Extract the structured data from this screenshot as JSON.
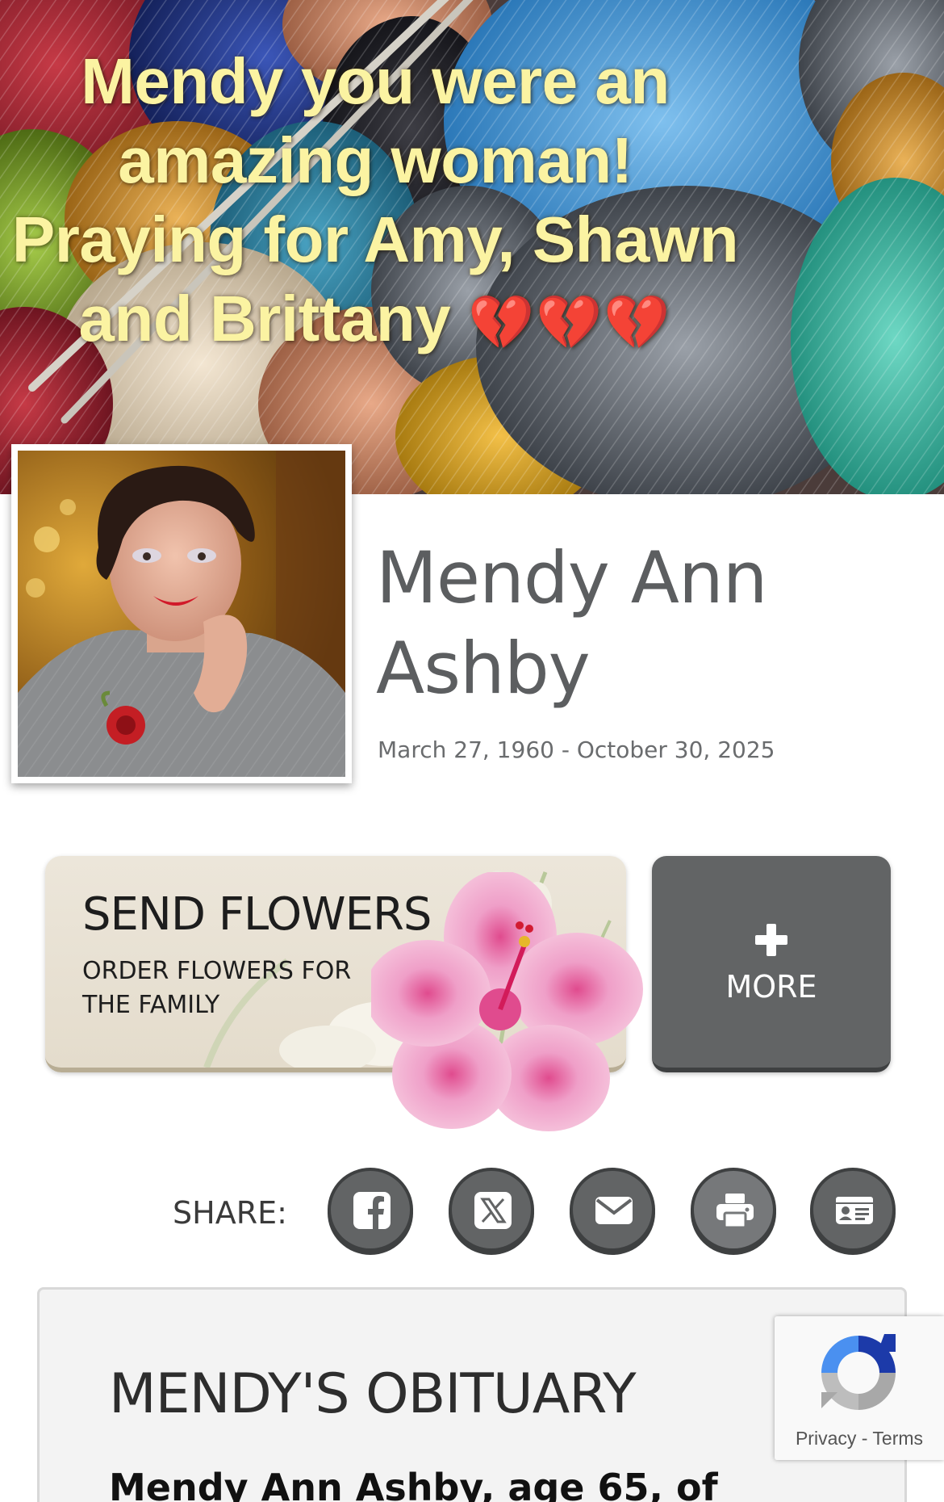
{
  "hero": {
    "message": "Mendy you were an amazing woman! Praying for Amy, Shawn and Brittany",
    "hearts": "💔💔💔"
  },
  "profile": {
    "name": "Mendy Ann Ashby",
    "dates": "March 27, 1960 - October 30, 2025"
  },
  "actions": {
    "flowers_title": "SEND FLOWERS",
    "flowers_subtitle": "ORDER FLOWERS FOR THE FAMILY",
    "more_label": "MORE",
    "more_icon": "plus-icon"
  },
  "share": {
    "label": "SHARE:",
    "buttons": [
      {
        "icon": "facebook-icon"
      },
      {
        "icon": "x-icon"
      },
      {
        "icon": "email-icon"
      },
      {
        "icon": "print-icon"
      },
      {
        "icon": "contact-card-icon"
      }
    ]
  },
  "obituary": {
    "heading": "MENDY'S OBITUARY",
    "first_line": "Mendy Ann Ashby, age 65, of"
  },
  "recaptcha": {
    "privacy": "Privacy",
    "separator": " - ",
    "terms": "Terms"
  },
  "colors": {
    "hero_text": "#fbf3a2",
    "button_dark": "#626465",
    "name_gray": "#5c5e60",
    "flower_pink": "#ef9fc8"
  }
}
